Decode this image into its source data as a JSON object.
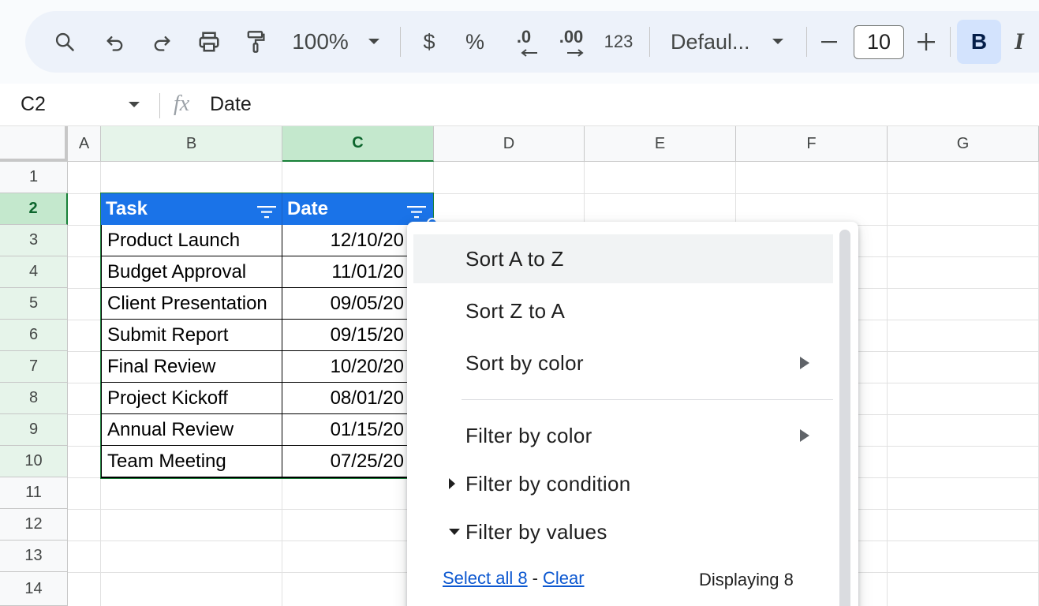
{
  "toolbar": {
    "zoom": "100%",
    "currency": "$",
    "percent": "%",
    "decrease_decimal": ".0",
    "increase_decimal": ".00",
    "number_format": "123",
    "font_family": "Defaul...",
    "font_size": "10",
    "bold": "B",
    "italic": "I"
  },
  "formula_bar": {
    "cell_ref": "C2",
    "fx": "fx",
    "value": "Date"
  },
  "columns": [
    "A",
    "B",
    "C",
    "D",
    "E",
    "F",
    "G"
  ],
  "rows": [
    "1",
    "2",
    "3",
    "4",
    "5",
    "6",
    "7",
    "8",
    "9",
    "10",
    "11",
    "12",
    "13",
    "14"
  ],
  "table": {
    "headers": [
      "Task",
      "Date"
    ],
    "rows": [
      [
        "Product Launch",
        "12/10/20"
      ],
      [
        "Budget Approval",
        "11/01/20"
      ],
      [
        "Client Presentation",
        "09/05/20"
      ],
      [
        "Submit Report",
        "09/15/20"
      ],
      [
        "Final Review",
        "10/20/20"
      ],
      [
        "Project Kickoff",
        "08/01/20"
      ],
      [
        "Annual Review",
        "01/15/20"
      ],
      [
        "Team Meeting",
        "07/25/20"
      ]
    ]
  },
  "menu": {
    "sort_az": "Sort A to Z",
    "sort_za": "Sort Z to A",
    "sort_by_color": "Sort by color",
    "filter_by_color": "Filter by color",
    "filter_by_condition": "Filter by condition",
    "filter_by_values": "Filter by values",
    "select_all": "Select all 8",
    "dash": "-",
    "clear": "Clear",
    "displaying": "Displaying 8"
  },
  "colors": {
    "header_fill": "#1a73e8",
    "selection": "#188038",
    "toolbar_bg": "#edf2fa",
    "bold_active": "#d3e3fd",
    "link": "#0b57d0"
  }
}
